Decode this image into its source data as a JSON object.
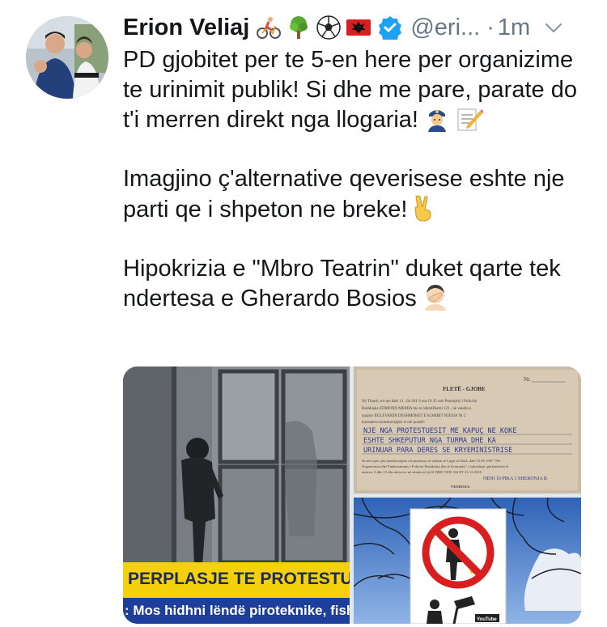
{
  "author": {
    "display_name": "Erion Veliaj",
    "handle": "@eri...",
    "separator": "·",
    "time": "1m",
    "emojis": [
      "cyclist-icon",
      "tree-icon",
      "soccer-ball-icon",
      "albania-flag-icon"
    ],
    "verified": true
  },
  "tweet": {
    "paragraphs": [
      {
        "text": "PD gjobitet per te 5-en here per organizime te urinimit publik! Si dhe me pare, parate do t'i merren direkt nga llogaria!",
        "emojis": [
          "police-officer-icon",
          "memo-icon"
        ]
      },
      {
        "text": "Imagjino ç'alternative qeverisese eshte nje parti qe i shpeton ne breke!",
        "emojis": [
          "victory-hand-icon"
        ]
      },
      {
        "text": "Hipokrizia e \"Mbro Teatrin\" duket qarte tek ndertesa e Gherardo Bosios",
        "emojis": [
          "facepalm-icon"
        ]
      }
    ]
  },
  "media": {
    "left_image": {
      "banner": "PERPLASJE TE PROTESTUESVE",
      "ticker": ": Mos hidhni lëndë piroteknike, fish"
    },
    "fine_document": {
      "title": "FLETË - GJOBE",
      "number_label": "Nr.",
      "lines": [
        "Në Tiranë, sot me datë 13 . 04 201 9 ora 19 35 unë Punonjësi i Policisë",
        "Bashkiake EDMOND MEMIA me nr identifikimi 121 , në vendin e",
        "quajtur BULEVARDI DESHMORET E KOMBIT NJESIA Nr 2",
        "konstatova kundravajtjen si më poshtë:",
        "NJE NGA PROTESTUESIT ME KAPUÇ NE KOKE",
        "ESHTE SHKEPUTUR NGA TURMA DHE KA",
        "URINUAR PARA DERES SE KRYEMINISTRISE",
        "Sa më sipër, për kundravajtjen e konstatuar, në zbatim të Ligjit nr 8224, datë 15.05.1997 \"Për",
        "Organizimin dhe Funksionimin e Policisë Bashkiake dhe të Komunës\", i ndryshuar, përkatësisht të",
        "neneve, 8 dhe 13 dhe aktiveve në zbatim të tij SI DHE VKB 156 DT 21.12.2018",
        "NENI 10 PIKA 1 SHERONJA B",
        "VENDOSA:"
      ]
    },
    "sign_image": {
      "caption": "YouTube"
    }
  },
  "icons": {
    "verified": "verified-badge-icon",
    "caret": "chevron-down-icon"
  },
  "colors": {
    "text": "#14171a",
    "secondary": "#657786",
    "verified": "#1da1f2",
    "banner_yellow": "#f4d10a",
    "ticker_blue": "#1d3e9a"
  }
}
